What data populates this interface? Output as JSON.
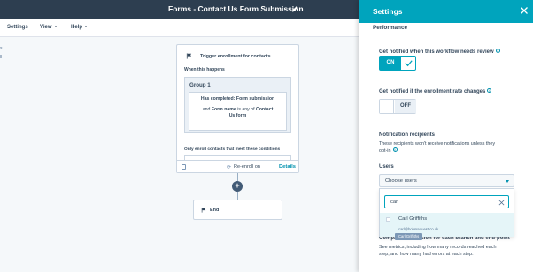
{
  "header": {
    "title": "Forms - Contact Us Form Submission"
  },
  "toolbar": {
    "settings": "Settings",
    "view": "View",
    "help": "Help"
  },
  "left_edge": {
    "cut_a": "s",
    "cut_b": "ll"
  },
  "trigger": {
    "title": "Trigger enrollment for contacts",
    "when": "When this happens",
    "group_title": "Group 1",
    "cond_line1_label": "Has completed:",
    "cond_line1_value": "Form submission",
    "cond_and": "and",
    "cond_field": "Form name",
    "cond_op": "is any of",
    "cond_value_a": "Contact",
    "cond_value_b": "Us form",
    "only_enroll": "Only enroll contacts that meet these conditions",
    "reenroll": "Re-enroll on",
    "details": "Details"
  },
  "add_action": "+",
  "end_card": {
    "label": "End"
  },
  "settings_panel": {
    "title": "Settings",
    "performance": "Performance",
    "notify_review": "Get notified when this workflow needs review",
    "notify_review_toggle": "ON",
    "notify_rate": "Get notified if the enrollment rate changes",
    "notify_rate_toggle": "OFF",
    "recipients_title": "Notification recipients",
    "recipients_desc1": "These recipients won't receive notifications unless they",
    "recipients_desc2": "opt-in",
    "users_label": "Users",
    "users_select": "Choose users",
    "search_value": "carl",
    "option_name": "Carl Griffiths",
    "option_email": "carl@bobsrequest.co.uk",
    "option_tooltip": "Carl Griffiths",
    "compare_title": "Compare conversion for each branch and end-point",
    "compare_desc1": "See metrics, including how many records reached each",
    "compare_desc2": "step, and how many had errors at each step."
  },
  "colors": {
    "header": "#2d3e50",
    "accent": "#00a4bd",
    "link": "#0091ae"
  }
}
